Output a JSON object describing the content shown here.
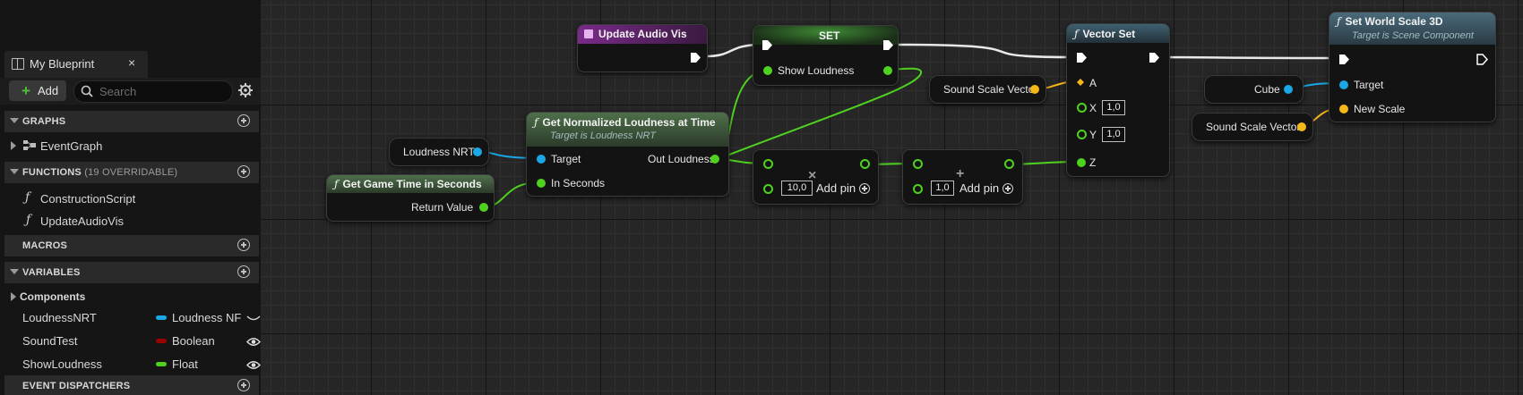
{
  "panel": {
    "tab_title": "My Blueprint",
    "close_glyph": "×",
    "add_label": "Add",
    "add_glyph": "+",
    "search_placeholder": "Search",
    "sections": {
      "graphs": "GRAPHS",
      "functions": "FUNCTIONS",
      "functions_sub": "(19 OVERRIDABLE)",
      "macros": "MACROS",
      "variables": "VARIABLES",
      "event_dispatchers": "EVENT DISPATCHERS"
    },
    "graph_items": [
      "EventGraph"
    ],
    "function_items": [
      "ConstructionScript",
      "UpdateAudioVis"
    ],
    "components_label": "Components",
    "variables": [
      {
        "name": "LoudnessNRT",
        "type": "Loudness NF",
        "color": "#1aa7e6"
      },
      {
        "name": "SoundTest",
        "type": "Boolean",
        "color": "#9b0000"
      },
      {
        "name": "ShowLoudness",
        "type": "Float",
        "color": "#4fd120"
      }
    ]
  },
  "graph": {
    "entry": {
      "title": "Update Audio Vis",
      "color": "#7a2a8a"
    },
    "set": {
      "title": "SET",
      "pin": "Show Loudness",
      "color": "#2e6b2a"
    },
    "get_loudness": {
      "title": "Get Normalized Loudness at Time",
      "subtitle": "Target is Loudness NRT",
      "in1": "Target",
      "in2": "In Seconds",
      "out": "Out Loudness"
    },
    "game_time": {
      "title": "Get Game Time in Seconds",
      "out": "Return Value"
    },
    "var_loudness_nrt": "Loudness NRT",
    "multiply": {
      "value": "10,0",
      "add_pin": "Add pin",
      "op": "×"
    },
    "add": {
      "value": "1,0",
      "add_pin": "Add pin",
      "op": "+"
    },
    "sound_scale_1": "Sound Scale Vector",
    "sound_scale_2": "Sound Scale Vector",
    "cube": "Cube",
    "vector_set": {
      "title": "Vector Set",
      "a": "A",
      "x": "X",
      "y": "Y",
      "z": "Z",
      "x_val": "1,0",
      "y_val": "1,0"
    },
    "set_world_scale": {
      "title": "Set World Scale 3D",
      "subtitle": "Target is Scene Component",
      "target": "Target",
      "new_scale": "New Scale"
    }
  }
}
